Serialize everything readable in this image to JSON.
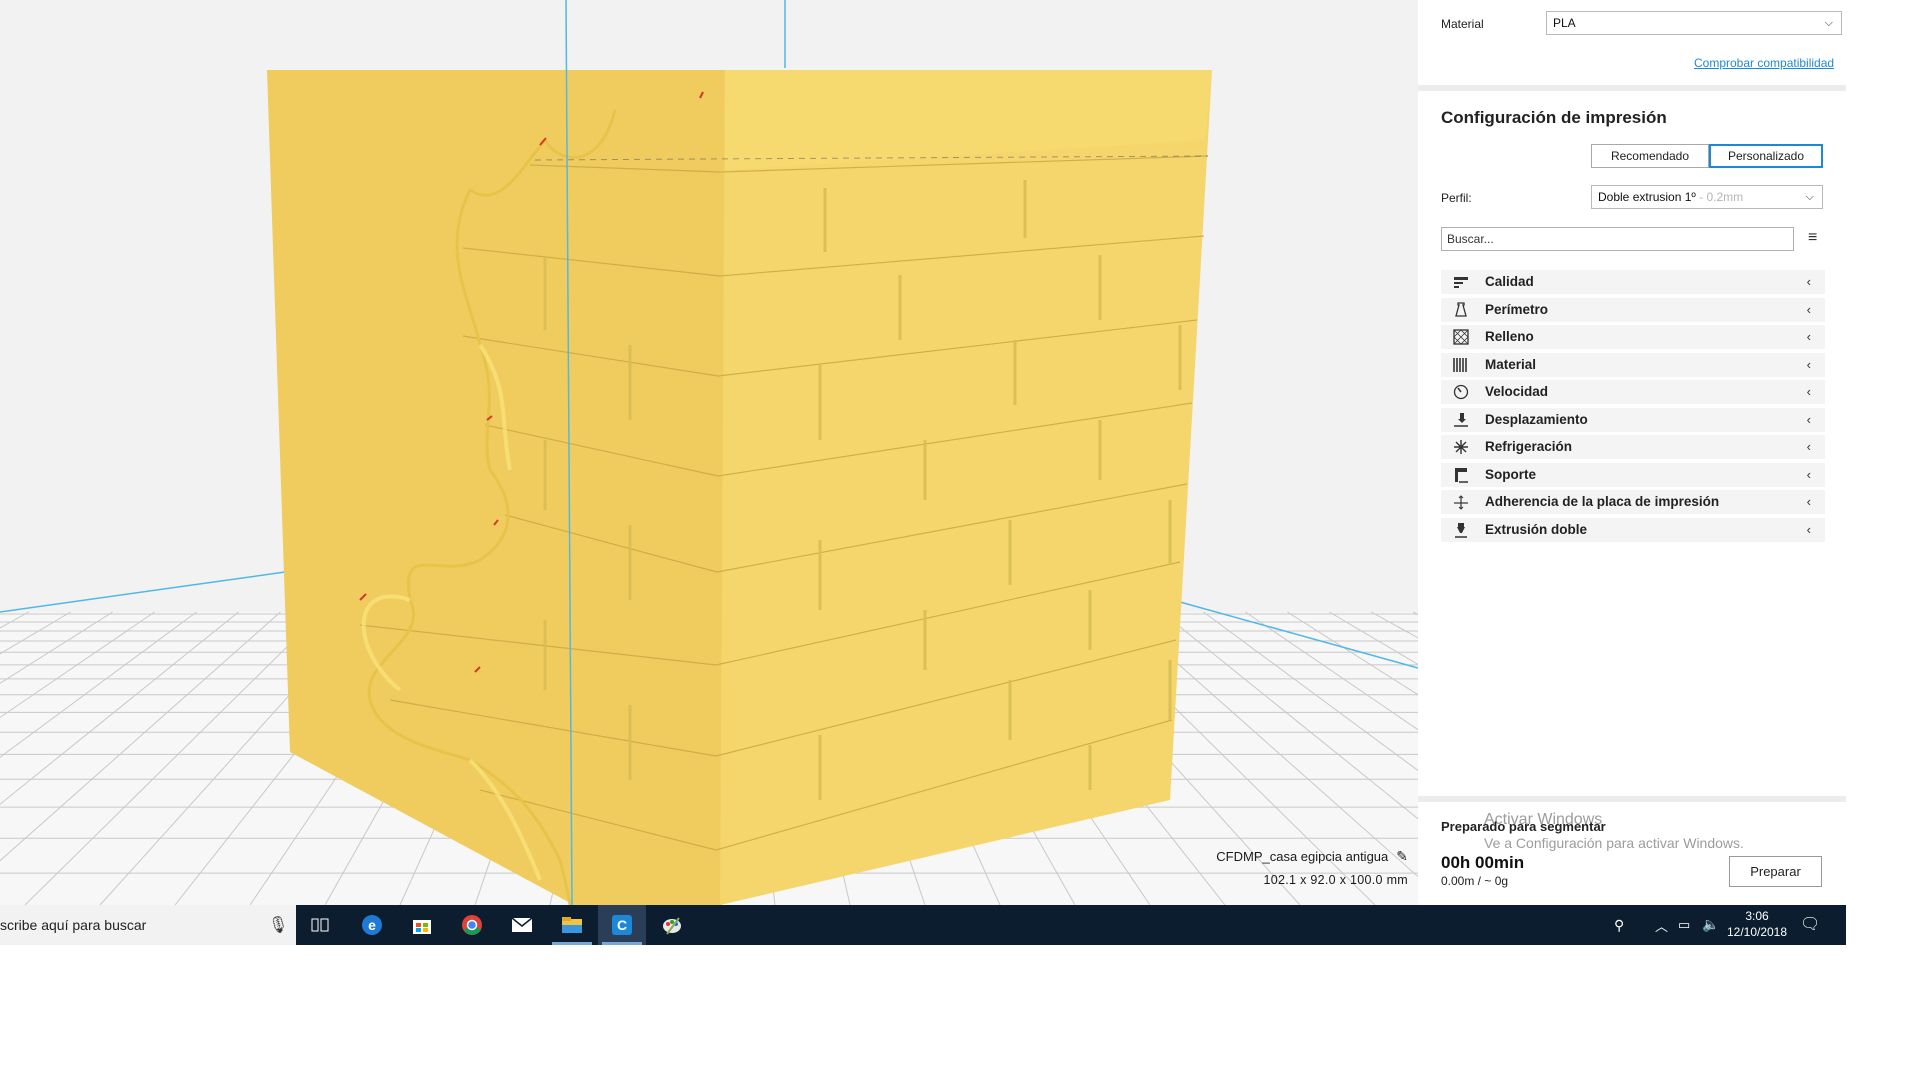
{
  "viewport": {
    "model_name": "CFDMP_casa egipcia antigua",
    "model_dimensions": "102.1 x 92.0 x 100.0 mm",
    "model_color": "#f5d56a",
    "grid_color": "#c8c8c8",
    "axis_color": "#4fb8e6"
  },
  "panel": {
    "material_label": "Material",
    "material_value": "PLA",
    "compat_link": "Comprobar compatibilidad",
    "section_title": "Configuración de impresión",
    "mode_recommended": "Recomendado",
    "mode_custom": "Personalizado",
    "profile_label": "Perfil:",
    "profile_value": "Doble extrusion 1º",
    "profile_suffix": " - 0.2mm",
    "search_placeholder": "Buscar...",
    "categories": [
      {
        "label": "Calidad",
        "icon": "quality-icon"
      },
      {
        "label": "Perímetro",
        "icon": "shell-icon"
      },
      {
        "label": "Relleno",
        "icon": "infill-icon"
      },
      {
        "label": "Material",
        "icon": "material-icon"
      },
      {
        "label": "Velocidad",
        "icon": "speed-icon"
      },
      {
        "label": "Desplazamiento",
        "icon": "travel-icon"
      },
      {
        "label": "Refrigeración",
        "icon": "cooling-icon"
      },
      {
        "label": "Soporte",
        "icon": "support-icon"
      },
      {
        "label": "Adherencia de la placa de impresión",
        "icon": "adhesion-icon"
      },
      {
        "label": "Extrusión doble",
        "icon": "dual-extrusion-icon"
      }
    ],
    "status_label": "Preparado para segmentar",
    "time": "00h 00min",
    "usage": "0.00m / ~ 0g",
    "prepare_button": "Preparar",
    "watermark_title": "Activar Windows",
    "watermark_sub": "Ve a Configuración para activar Windows."
  },
  "taskbar": {
    "search_text": "scribe aquí para buscar",
    "apps": [
      "task-view-icon",
      "edge-icon",
      "store-icon",
      "chrome-icon",
      "mail-icon",
      "file-explorer-icon",
      "cura-icon",
      "paint-icon"
    ],
    "time": "3:06",
    "date": "12/10/2018"
  }
}
